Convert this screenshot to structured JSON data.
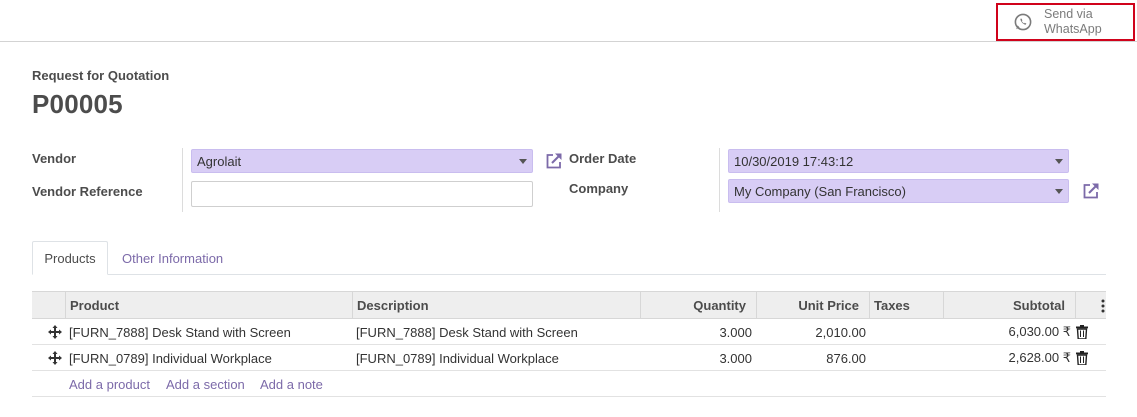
{
  "header": {
    "whatsapp_button": "Send via\nWhatsApp",
    "whatsapp_line1": "Send via",
    "whatsapp_line2": "WhatsApp",
    "accent_color": "#7c6aa9",
    "highlight_color": "#d0021b"
  },
  "document": {
    "subtitle": "Request for Quotation",
    "name": "P00005"
  },
  "form": {
    "vendor_label": "Vendor",
    "vendor_value": "Agrolait",
    "vendor_reference_label": "Vendor Reference",
    "vendor_reference_value": "",
    "order_date_label": "Order Date",
    "order_date_value": "10/30/2019 17:43:12",
    "company_label": "Company",
    "company_value": "My Company (San Francisco)"
  },
  "tabs": [
    {
      "label": "Products",
      "active": true
    },
    {
      "label": "Other Information",
      "active": false
    }
  ],
  "table": {
    "columns": [
      "Product",
      "Description",
      "Quantity",
      "Unit Price",
      "Taxes",
      "Subtotal"
    ],
    "rows": [
      {
        "product": "[FURN_7888] Desk Stand with Screen",
        "description": "[FURN_7888] Desk Stand with Screen",
        "quantity": "3.000",
        "unit_price": "2,010.00",
        "taxes": "",
        "subtotal": "6,030.00 ₹"
      },
      {
        "product": "[FURN_0789] Individual Workplace",
        "description": "[FURN_0789] Individual Workplace",
        "quantity": "3.000",
        "unit_price": "876.00",
        "taxes": "",
        "subtotal": "2,628.00 ₹"
      }
    ],
    "add_links": [
      "Add a product",
      "Add a section",
      "Add a note"
    ]
  }
}
